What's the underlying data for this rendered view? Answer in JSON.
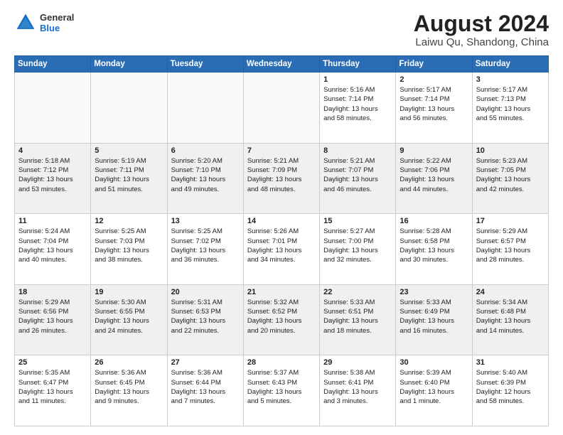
{
  "header": {
    "logo_general": "General",
    "logo_blue": "Blue",
    "main_title": "August 2024",
    "subtitle": "Laiwu Qu, Shandong, China"
  },
  "days_of_week": [
    "Sunday",
    "Monday",
    "Tuesday",
    "Wednesday",
    "Thursday",
    "Friday",
    "Saturday"
  ],
  "weeks": [
    [
      {
        "day": "",
        "info": ""
      },
      {
        "day": "",
        "info": ""
      },
      {
        "day": "",
        "info": ""
      },
      {
        "day": "",
        "info": ""
      },
      {
        "day": "1",
        "info": "Sunrise: 5:16 AM\nSunset: 7:14 PM\nDaylight: 13 hours\nand 58 minutes."
      },
      {
        "day": "2",
        "info": "Sunrise: 5:17 AM\nSunset: 7:14 PM\nDaylight: 13 hours\nand 56 minutes."
      },
      {
        "day": "3",
        "info": "Sunrise: 5:17 AM\nSunset: 7:13 PM\nDaylight: 13 hours\nand 55 minutes."
      }
    ],
    [
      {
        "day": "4",
        "info": "Sunrise: 5:18 AM\nSunset: 7:12 PM\nDaylight: 13 hours\nand 53 minutes."
      },
      {
        "day": "5",
        "info": "Sunrise: 5:19 AM\nSunset: 7:11 PM\nDaylight: 13 hours\nand 51 minutes."
      },
      {
        "day": "6",
        "info": "Sunrise: 5:20 AM\nSunset: 7:10 PM\nDaylight: 13 hours\nand 49 minutes."
      },
      {
        "day": "7",
        "info": "Sunrise: 5:21 AM\nSunset: 7:09 PM\nDaylight: 13 hours\nand 48 minutes."
      },
      {
        "day": "8",
        "info": "Sunrise: 5:21 AM\nSunset: 7:07 PM\nDaylight: 13 hours\nand 46 minutes."
      },
      {
        "day": "9",
        "info": "Sunrise: 5:22 AM\nSunset: 7:06 PM\nDaylight: 13 hours\nand 44 minutes."
      },
      {
        "day": "10",
        "info": "Sunrise: 5:23 AM\nSunset: 7:05 PM\nDaylight: 13 hours\nand 42 minutes."
      }
    ],
    [
      {
        "day": "11",
        "info": "Sunrise: 5:24 AM\nSunset: 7:04 PM\nDaylight: 13 hours\nand 40 minutes."
      },
      {
        "day": "12",
        "info": "Sunrise: 5:25 AM\nSunset: 7:03 PM\nDaylight: 13 hours\nand 38 minutes."
      },
      {
        "day": "13",
        "info": "Sunrise: 5:25 AM\nSunset: 7:02 PM\nDaylight: 13 hours\nand 36 minutes."
      },
      {
        "day": "14",
        "info": "Sunrise: 5:26 AM\nSunset: 7:01 PM\nDaylight: 13 hours\nand 34 minutes."
      },
      {
        "day": "15",
        "info": "Sunrise: 5:27 AM\nSunset: 7:00 PM\nDaylight: 13 hours\nand 32 minutes."
      },
      {
        "day": "16",
        "info": "Sunrise: 5:28 AM\nSunset: 6:58 PM\nDaylight: 13 hours\nand 30 minutes."
      },
      {
        "day": "17",
        "info": "Sunrise: 5:29 AM\nSunset: 6:57 PM\nDaylight: 13 hours\nand 28 minutes."
      }
    ],
    [
      {
        "day": "18",
        "info": "Sunrise: 5:29 AM\nSunset: 6:56 PM\nDaylight: 13 hours\nand 26 minutes."
      },
      {
        "day": "19",
        "info": "Sunrise: 5:30 AM\nSunset: 6:55 PM\nDaylight: 13 hours\nand 24 minutes."
      },
      {
        "day": "20",
        "info": "Sunrise: 5:31 AM\nSunset: 6:53 PM\nDaylight: 13 hours\nand 22 minutes."
      },
      {
        "day": "21",
        "info": "Sunrise: 5:32 AM\nSunset: 6:52 PM\nDaylight: 13 hours\nand 20 minutes."
      },
      {
        "day": "22",
        "info": "Sunrise: 5:33 AM\nSunset: 6:51 PM\nDaylight: 13 hours\nand 18 minutes."
      },
      {
        "day": "23",
        "info": "Sunrise: 5:33 AM\nSunset: 6:49 PM\nDaylight: 13 hours\nand 16 minutes."
      },
      {
        "day": "24",
        "info": "Sunrise: 5:34 AM\nSunset: 6:48 PM\nDaylight: 13 hours\nand 14 minutes."
      }
    ],
    [
      {
        "day": "25",
        "info": "Sunrise: 5:35 AM\nSunset: 6:47 PM\nDaylight: 13 hours\nand 11 minutes."
      },
      {
        "day": "26",
        "info": "Sunrise: 5:36 AM\nSunset: 6:45 PM\nDaylight: 13 hours\nand 9 minutes."
      },
      {
        "day": "27",
        "info": "Sunrise: 5:36 AM\nSunset: 6:44 PM\nDaylight: 13 hours\nand 7 minutes."
      },
      {
        "day": "28",
        "info": "Sunrise: 5:37 AM\nSunset: 6:43 PM\nDaylight: 13 hours\nand 5 minutes."
      },
      {
        "day": "29",
        "info": "Sunrise: 5:38 AM\nSunset: 6:41 PM\nDaylight: 13 hours\nand 3 minutes."
      },
      {
        "day": "30",
        "info": "Sunrise: 5:39 AM\nSunset: 6:40 PM\nDaylight: 13 hours\nand 1 minute."
      },
      {
        "day": "31",
        "info": "Sunrise: 5:40 AM\nSunset: 6:39 PM\nDaylight: 12 hours\nand 58 minutes."
      }
    ]
  ]
}
